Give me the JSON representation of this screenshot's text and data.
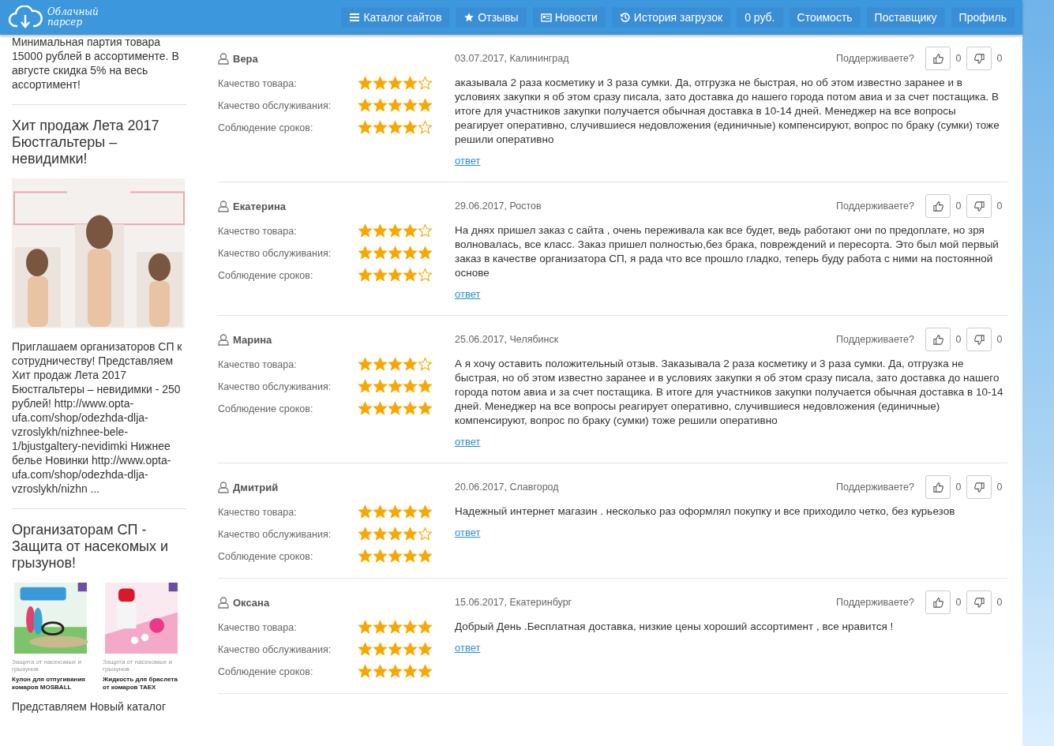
{
  "header": {
    "logo": "Облачный парсер",
    "nav": [
      {
        "label": "Каталог сайтов"
      },
      {
        "label": "Отзывы"
      },
      {
        "label": "Новости"
      },
      {
        "label": "История загрузок"
      },
      {
        "label": "0 руб."
      },
      {
        "label": "Стоимость"
      },
      {
        "label": "Поставщику"
      },
      {
        "label": "Профиль"
      }
    ]
  },
  "sidebar": {
    "blocks": [
      {
        "kind": "text",
        "text": "Минимальная партия товара 15000 рублей в ассортименте. В августе скидка 5% на весь ассортимент!"
      },
      {
        "kind": "heading",
        "text": "Хит продаж Лета 2017 Бюстгальтеры – невидимки!"
      },
      {
        "kind": "picture"
      },
      {
        "kind": "text",
        "text": "Приглашаем организаторов СП к сотрудничеству! Представляем Хит продаж Лета 2017 Бюстгальтеры – невидимки - 250 рублей! http://www.opta-ufa.com/shop/odezhda-dlja-vzroslykh/nizhnee-bele-1/bjustgaltery-nevidimki Нижнее белье Новинки http://www.opta-ufa.com/shop/odezhda-dlja-vzroslykh/nizhn ..."
      },
      {
        "kind": "heading",
        "text": "Организаторам СП - Защита от насекомых и грызунов!"
      },
      {
        "kind": "products",
        "items": [
          {
            "category": "Защита от насекомых и грызунов",
            "title": "Кулон для отпугивания комаров MOSBALL"
          },
          {
            "category": "Защита от насекомых и грызунов",
            "title": "Жидкость для браслета от комаров TAEX"
          }
        ]
      },
      {
        "kind": "text",
        "text": "Представляем Новый каталог"
      }
    ]
  },
  "reviews": [
    {
      "name": "Вера",
      "date": "03.07.2017, Калининград",
      "support": "Поддерживаете?",
      "likes": "0",
      "dislikes": "0",
      "ratings": [
        {
          "label": "Качество товара:",
          "stars": 4
        },
        {
          "label": "Качество обслуживания:",
          "stars": 5
        },
        {
          "label": "Соблюдение сроков:",
          "stars": 4
        }
      ],
      "text": "аказывала 2 раза косметику и 3 раза сумки. Да, отгрузка не быстрая, но об этом известно заранее и в условиях закупки я об этом сразу писала, зато доставка до нашего города потом авиа и за счет постащика. В итоге для участников закупки получается обычная доставка в 10-14 дней. Менеджер на все вопросы реагирует оперативно, случившиеся недовложения (единичные) компенсируют, вопрос по браку (сумки) тоже решили оперативно",
      "reply": "ответ"
    },
    {
      "name": "Екатерина",
      "date": "29.06.2017, Ростов",
      "support": "Поддерживаете?",
      "likes": "0",
      "dislikes": "0",
      "ratings": [
        {
          "label": "Качество товара:",
          "stars": 4
        },
        {
          "label": "Качество обслуживания:",
          "stars": 5
        },
        {
          "label": "Соблюдение сроков:",
          "stars": 4
        }
      ],
      "text": "На днях пришел заказ с сайта , очень переживала как все будет, ведь работают они по предоплате, но зря волновалась, все класс. Заказ пришел полностью,без брака, повреждений и пересорта. Это был мой первый заказ в качестве организатора СП, я рада что все прошло гладко, теперь буду работа с ними на постоянной основе",
      "reply": "ответ"
    },
    {
      "name": "Марина",
      "date": "25.06.2017, Челябинск",
      "support": "Поддерживаете?",
      "likes": "0",
      "dislikes": "0",
      "ratings": [
        {
          "label": "Качество товара:",
          "stars": 4
        },
        {
          "label": "Качество обслуживания:",
          "stars": 5
        },
        {
          "label": "Соблюдение сроков:",
          "stars": 5
        }
      ],
      "text": "А я хочу оставить положительный отзыв. Заказывала 2 раза косметику и 3 раза сумки. Да, отгрузка не быстрая, но об этом известно заранее и в условиях закупки я об этом сразу писала, зато доставка до нашего города потом авиа и за счет постащика. В итоге для участников закупки получается обычная доставка в 10-14 дней. Менеджер на все вопросы реагирует оперативно, случившиеся недовложения (единичные) компенсируют, вопрос по браку (сумки) тоже решили оперативно",
      "reply": "ответ"
    },
    {
      "name": "Дмитрий",
      "date": "20.06.2017, Славгород",
      "support": "Поддерживаете?",
      "likes": "0",
      "dislikes": "0",
      "ratings": [
        {
          "label": "Качество товара:",
          "stars": 5
        },
        {
          "label": "Качество обслуживания:",
          "stars": 4
        },
        {
          "label": "Соблюдение сроков:",
          "stars": 5
        }
      ],
      "text": "Надежный интернет магазин . несколько раз оформлял покупку и все приходило четко, без курьезов",
      "reply": "ответ"
    },
    {
      "name": "Оксана",
      "date": "15.06.2017, Екатеринбург",
      "support": "Поддерживаете?",
      "likes": "0",
      "dislikes": "0",
      "ratings": [
        {
          "label": "Качество товара:",
          "stars": 5
        },
        {
          "label": "Качество обслуживания:",
          "stars": 5
        },
        {
          "label": "Соблюдение сроков:",
          "stars": 5
        }
      ],
      "text": "Добрый День .Бесплатная доставка, низкие цены хороший ассортимент , все нравится !",
      "reply": "ответ"
    }
  ]
}
